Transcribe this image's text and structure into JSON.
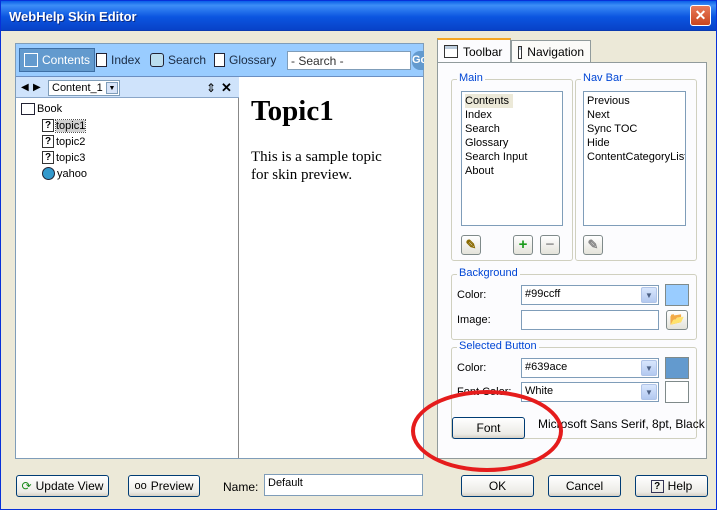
{
  "window": {
    "title": "WebHelp Skin Editor",
    "close_glyph": "✕"
  },
  "preview": {
    "nav_buttons": [
      {
        "label": "Contents",
        "icon": "book-icon",
        "active": true
      },
      {
        "label": "Index",
        "icon": "index-icon"
      },
      {
        "label": "Search",
        "icon": "search-icon"
      },
      {
        "label": "Glossary",
        "icon": "glossary-icon"
      }
    ],
    "search_placeholder": "- Search -",
    "go_label": "Go",
    "toc": {
      "select_value": "Content_1",
      "tree": [
        {
          "label": "Book",
          "icon": "book-icon",
          "level": 0
        },
        {
          "label": "topic1",
          "icon": "topic-icon",
          "level": 1,
          "selected": true
        },
        {
          "label": "topic2",
          "icon": "topic-icon",
          "level": 1
        },
        {
          "label": "topic3",
          "icon": "topic-icon",
          "level": 1
        },
        {
          "label": "yahoo",
          "icon": "url-icon",
          "level": 1
        }
      ]
    },
    "topic": {
      "title": "Topic1",
      "body": "This is a sample topic for skin preview."
    }
  },
  "tabs": [
    {
      "label": "Toolbar",
      "active": true
    },
    {
      "label": "Navigation",
      "active": false
    }
  ],
  "toolbar": {
    "main": {
      "title": "Main",
      "items": [
        "Contents",
        "Index",
        "Search",
        "Glossary",
        "Search Input",
        "About"
      ],
      "selected": "Contents"
    },
    "navbar": {
      "title": "Nav Bar",
      "items": [
        "Previous",
        "Next",
        "Sync TOC",
        "Hide",
        "ContentCategoryList"
      ]
    },
    "background": {
      "title": "Background",
      "color_label": "Color:",
      "color_value": "#99ccff",
      "swatch": "#99ccff",
      "image_label": "Image:",
      "image_value": ""
    },
    "selected_button": {
      "title": "Selected Button",
      "color_label": "Color:",
      "color_value": "#639ace",
      "swatch": "#639ace",
      "font_color_label": "Font Color:",
      "font_color_value": "White",
      "font_swatch": "#ffffff"
    },
    "font_button": "Font",
    "font_description": "Microsoft Sans Serif, 8pt, Black"
  },
  "bottom": {
    "update_view": "Update View",
    "preview": "Preview",
    "name_label": "Name:",
    "name_value": "Default",
    "ok": "OK",
    "cancel": "Cancel",
    "help": "Help"
  },
  "annotation_color": "#e51c1c"
}
